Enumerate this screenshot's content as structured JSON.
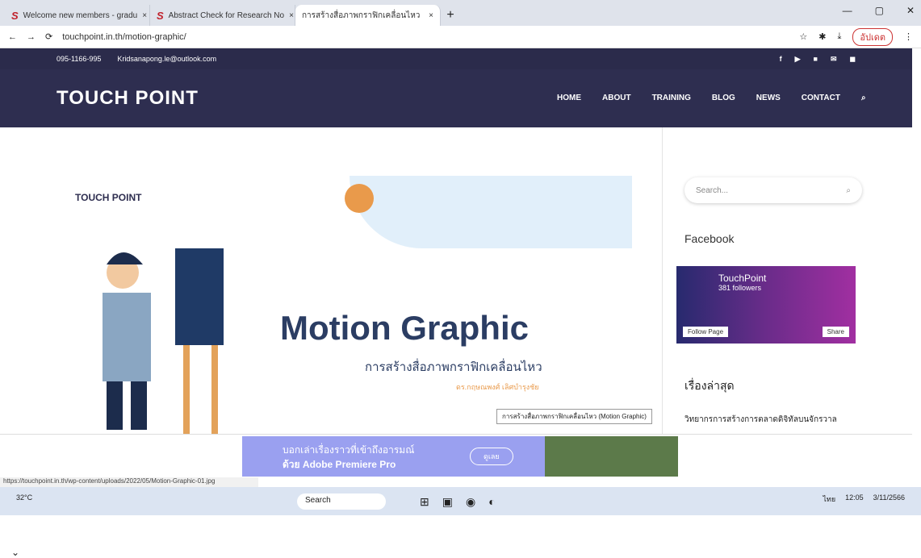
{
  "tabs": [
    "Welcome new members - gradu",
    "Abstract Check for Research No",
    "การสร้างสื่อภาพกราฟิกเคลื่อนไหว"
  ],
  "url": "touchpoint.in.th/motion-graphic/",
  "update_label": "อัปเดต",
  "topbar": {
    "phone": "095-1166-995",
    "email": "Kridsanapong.le@outlook.com"
  },
  "brand": "TOUCH POINT",
  "nav": [
    "HOME",
    "ABOUT",
    "TRAINING",
    "BLOG",
    "NEWS",
    "CONTACT"
  ],
  "hero": {
    "brand": "TOUCH POINT",
    "title": "Motion Graphic",
    "subtitle": "การสร้างสื่อภาพกราฟิกเคลื่อนไหว",
    "author": "ดร.กฤษณพงศ์ เลิศบำรุงชัย",
    "caption": "การสร้างสื่อภาพกราฟิกเคลื่อนไหว (Motion Graphic)"
  },
  "sidebar": {
    "search_placeholder": "Search...",
    "facebook_heading": "Facebook",
    "fb_name": "TouchPoint",
    "fb_followers": "381 followers",
    "follow": "Follow Page",
    "share": "Share",
    "recent_heading": "เรื่องล่าสุด",
    "recent_item": "วิทยากรการสร้างการตลาดดิจิทัลบนจักรวาล"
  },
  "ad": {
    "line1": "บอกเล่าเรื่องราวที่เข้าถึงอารมณ์",
    "line2": "ด้วย Adobe Premiere Pro",
    "btn": "ดูเลย"
  },
  "status": "https://touchpoint.in.th/wp-content/uploads/2022/05/Motion-Graphic-01.jpg",
  "taskbar": {
    "temp": "32°C",
    "search": "Search",
    "time": "12:05",
    "date": "3/11/2566",
    "lang": "ไทย"
  }
}
